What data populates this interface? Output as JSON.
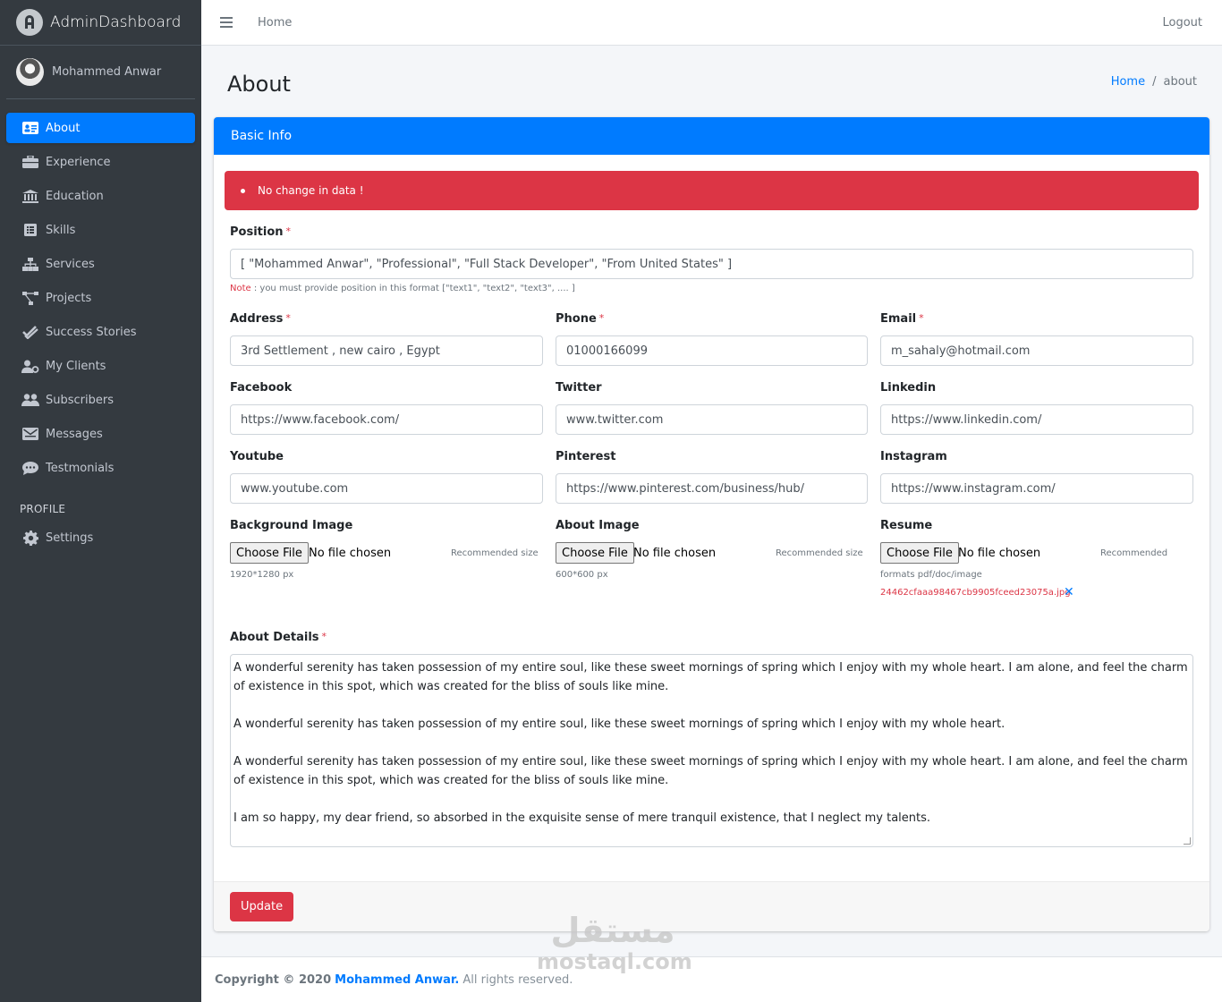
{
  "brand": {
    "name": "AdminDashboard"
  },
  "user": {
    "name": "Mohammed Anwar"
  },
  "sidebar": {
    "items": [
      {
        "label": "About",
        "icon": "id-card-icon",
        "active": true
      },
      {
        "label": "Experience",
        "icon": "briefcase-icon"
      },
      {
        "label": "Education",
        "icon": "university-icon"
      },
      {
        "label": "Skills",
        "icon": "list-icon"
      },
      {
        "label": "Services",
        "icon": "sitemap-icon"
      },
      {
        "label": "Projects",
        "icon": "project-diagram-icon"
      },
      {
        "label": "Success Stories",
        "icon": "check-double-icon"
      },
      {
        "label": "My Clients",
        "icon": "user-cog-icon"
      },
      {
        "label": "Subscribers",
        "icon": "users-icon"
      },
      {
        "label": "Messages",
        "icon": "envelope-icon"
      },
      {
        "label": "Testmonials",
        "icon": "comment-icon"
      }
    ],
    "profile_header": "PROFILE",
    "settings_label": "Settings"
  },
  "topbar": {
    "home": "Home",
    "logout": "Logout"
  },
  "page": {
    "title": "About",
    "breadcrumb": {
      "home": "Home",
      "separator": "/",
      "current": "about"
    }
  },
  "card": {
    "header": "Basic Info",
    "alert": "No change in data !",
    "required_mark": "*",
    "position": {
      "label": "Position",
      "value": "[ \"Mohammed Anwar\", \"Professional\", \"Full Stack Developer\", \"From United States\" ]",
      "note_key": "Note",
      "note_text": " : you must provide position in this format [\"text1\", \"text2\", \"text3\", .... ]"
    },
    "address": {
      "label": "Address",
      "value": "3rd Settlement , new cairo , Egypt"
    },
    "phone": {
      "label": "Phone",
      "value": "01000166099"
    },
    "email": {
      "label": "Email",
      "value": "m_sahaly@hotmail.com"
    },
    "facebook": {
      "label": "Facebook",
      "value": "https://www.facebook.com/"
    },
    "twitter": {
      "label": "Twitter",
      "value": "www.twitter.com"
    },
    "linkedin": {
      "label": "Linkedin",
      "value": "https://www.linkedin.com/"
    },
    "youtube": {
      "label": "Youtube",
      "value": "www.youtube.com"
    },
    "pinterest": {
      "label": "Pinterest",
      "value": "https://www.pinterest.com/business/hub/"
    },
    "instagram": {
      "label": "Instagram",
      "value": "https://www.instagram.com/"
    },
    "background_image": {
      "label": "Background Image",
      "button": "Choose File",
      "status": "No file chosen",
      "hint": "Recommended size",
      "hint2": "1920*1280 px"
    },
    "about_image": {
      "label": "About Image",
      "button": "Choose File",
      "status": "No file chosen",
      "hint": "Recommended size",
      "hint2": "600*600 px"
    },
    "resume": {
      "label": "Resume",
      "button": "Choose File",
      "status": "No file chosen",
      "hint": "Recommended",
      "hint2": "formats pdf/doc/image",
      "file": "24462cfaaa98467cb9905fceed23075a.jpg",
      "remove": "✕"
    },
    "about_details": {
      "label": "About Details",
      "paragraphs": [
        "A wonderful serenity has taken possession of my entire soul, like these sweet mornings of spring which I enjoy with my whole heart. I am alone, and feel the charm of existence in this spot, which was created for the bliss of souls like mine.",
        "A wonderful serenity has taken possession of my entire soul, like these sweet mornings of spring which I enjoy with my whole heart.",
        "A wonderful serenity has taken possession of my entire soul, like these sweet mornings of spring which I enjoy with my whole heart. I am alone, and feel the charm of existence in this spot, which was created for the bliss of souls like mine.",
        "I am so happy, my dear friend, so absorbed in the exquisite sense of mere tranquil existence, that I neglect my talents."
      ]
    },
    "update_button": "Update"
  },
  "footer": {
    "copyright": "Copyright © 2020",
    "author": "Mohammed Anwar.",
    "rights": "All rights reserved."
  },
  "watermark": {
    "arabic": "مستقل",
    "latin": "mostaql.com"
  },
  "colors": {
    "primary": "#007bff",
    "danger": "#dc3545",
    "sidebar": "#343a40"
  }
}
